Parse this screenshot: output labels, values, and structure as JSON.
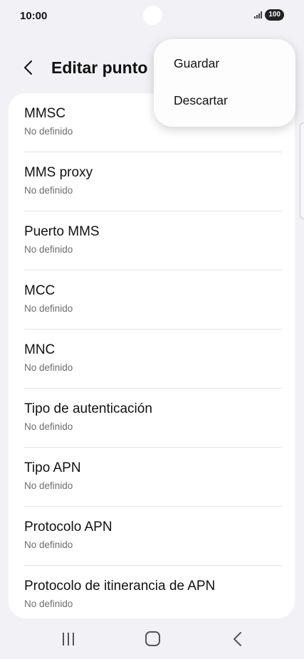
{
  "status_bar": {
    "time": "10:00",
    "battery": "100"
  },
  "header": {
    "title": "Editar punto"
  },
  "menu": {
    "items": [
      {
        "label": "Guardar"
      },
      {
        "label": "Descartar"
      }
    ]
  },
  "settings": [
    {
      "label": "MMSC",
      "value": "No definido"
    },
    {
      "label": "MMS proxy",
      "value": "No definido"
    },
    {
      "label": "Puerto MMS",
      "value": "No definido"
    },
    {
      "label": "MCC",
      "value": "No definido"
    },
    {
      "label": "MNC",
      "value": "No definido"
    },
    {
      "label": "Tipo de autenticación",
      "value": "No definido"
    },
    {
      "label": "Tipo APN",
      "value": "No definido"
    },
    {
      "label": "Protocolo APN",
      "value": "No definido"
    },
    {
      "label": "Protocolo de itinerancia de APN",
      "value": "No definido"
    }
  ]
}
